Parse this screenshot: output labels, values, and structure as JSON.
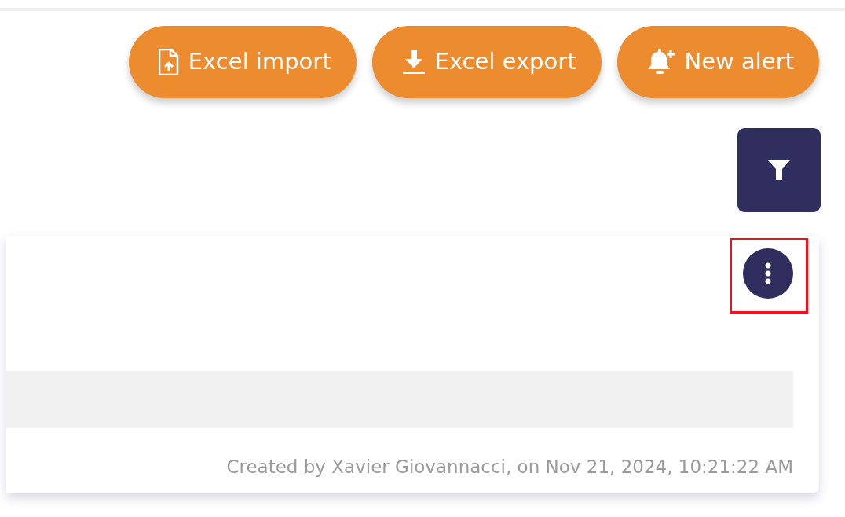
{
  "actions": [
    {
      "label": "Excel import",
      "kind": "import"
    },
    {
      "label": "Excel export",
      "kind": "export"
    },
    {
      "label": "New alert",
      "kind": "alert"
    }
  ],
  "filter_button": {
    "kind": "filter"
  },
  "card": {
    "menu_highlighted": true,
    "footer": "Created by Xavier Giovannacci, on Nov 21, 2024, 10:21:22 AM"
  }
}
